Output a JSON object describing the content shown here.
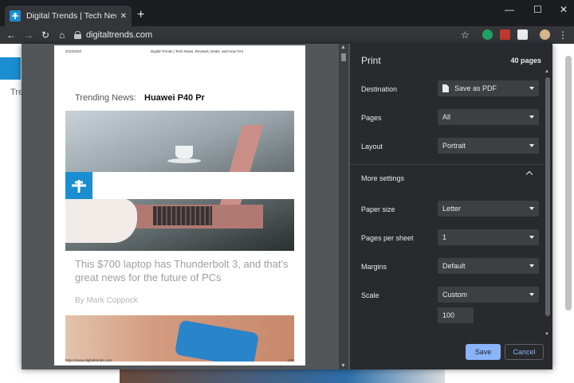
{
  "browser": {
    "tab_title": "Digital Trends | Tech News, Reviews, Deals, and How-To's",
    "url": "digitaltrends.com",
    "new_tab_symbol": "+",
    "close_symbol": "✕",
    "window_controls": [
      "—",
      "☐",
      "✕"
    ],
    "nav": {
      "back": "←",
      "forward": "→",
      "reload": "↻",
      "home": "⌂"
    }
  },
  "page_behind": {
    "visible_text": "Tre"
  },
  "preview": {
    "header_date": "3/10/2020",
    "header_title": "Digital Trends | Tech News, Reviews, Deals, and How-To's",
    "trending_label": "Trending News:",
    "trending_story": "Huawei P40 Pr",
    "headline": "This $700 laptop has Thunderbolt 3, and that's great news for the future of PCs",
    "byline": "By Mark Coppock",
    "footer_url": "https://www.digitaltrends.com",
    "footer_page": "1/40"
  },
  "print": {
    "title": "Print",
    "pages_count": "40 pages",
    "destination_label": "Destination",
    "destination_value": "Save as PDF",
    "pages_label": "Pages",
    "pages_value": "All",
    "layout_label": "Layout",
    "layout_value": "Portrait",
    "more_settings_label": "More settings",
    "paper_size_label": "Paper size",
    "paper_size_value": "Letter",
    "pages_per_sheet_label": "Pages per sheet",
    "pages_per_sheet_value": "1",
    "margins_label": "Margins",
    "margins_value": "Default",
    "scale_label": "Scale",
    "scale_value": "Custom",
    "scale_input_value": "100",
    "save_label": "Save",
    "cancel_label": "Cancel"
  },
  "colors": {
    "accent": "#8ab4f8",
    "brand": "#1a8ed1",
    "panel": "#292a2d",
    "control": "#3c4043"
  }
}
